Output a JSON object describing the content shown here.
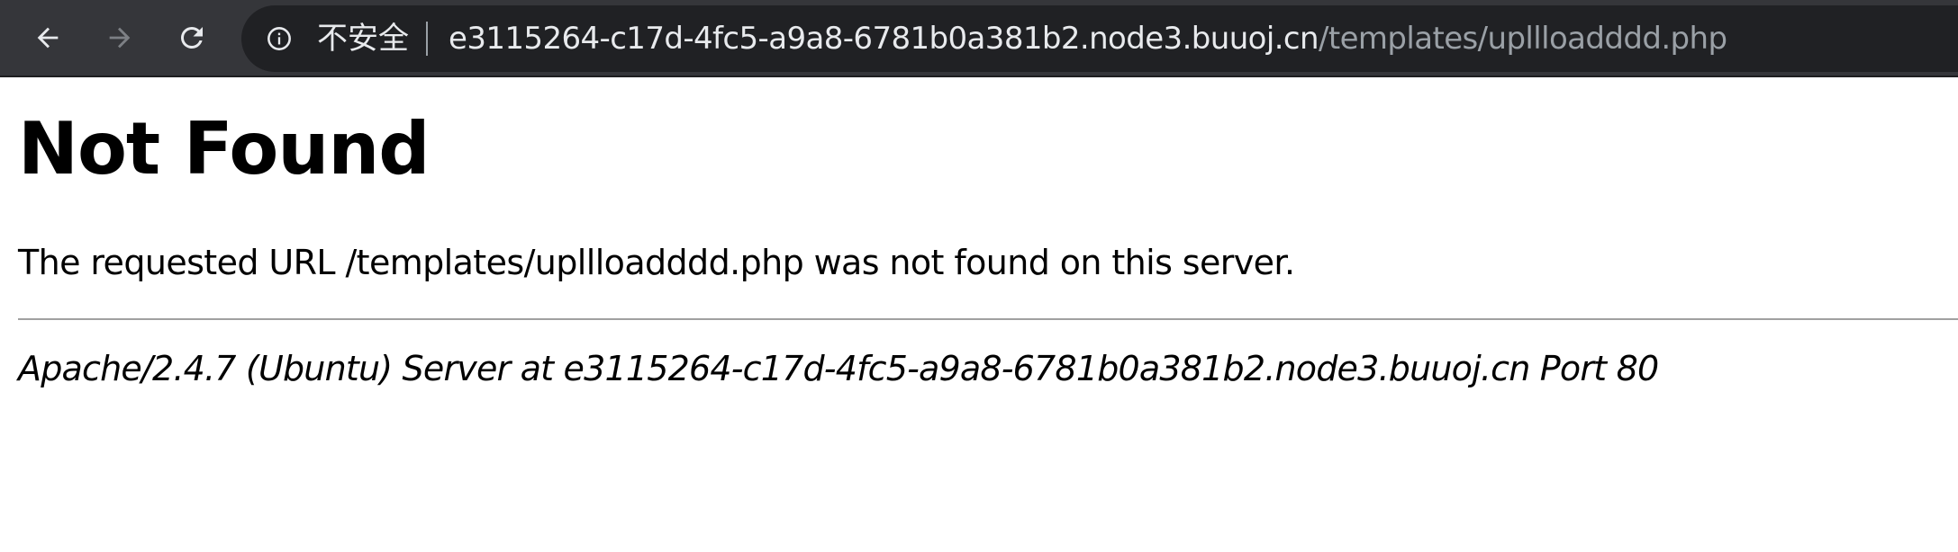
{
  "browser": {
    "security_label": "不安全",
    "url_host": "e3115264-c17d-4fc5-a9a8-6781b0a381b2.node3.buuoj.cn",
    "url_path": "/templates/upllloadddd.php",
    "icons": {
      "back": "back-arrow-icon",
      "forward": "forward-arrow-icon",
      "reload": "reload-icon",
      "info": "info-icon"
    },
    "colors": {
      "toolbar_bg": "#35363a",
      "omnibox_bg": "#202124",
      "url_host": "#e8eaed",
      "url_path": "#9aa0a6"
    }
  },
  "page": {
    "heading": "Not Found",
    "message": "The requested URL /templates/upllloadddd.php was not found on this server.",
    "server_signature": "Apache/2.4.7 (Ubuntu) Server at e3115264-c17d-4fc5-a9a8-6781b0a381b2.node3.buuoj.cn Port 80"
  }
}
